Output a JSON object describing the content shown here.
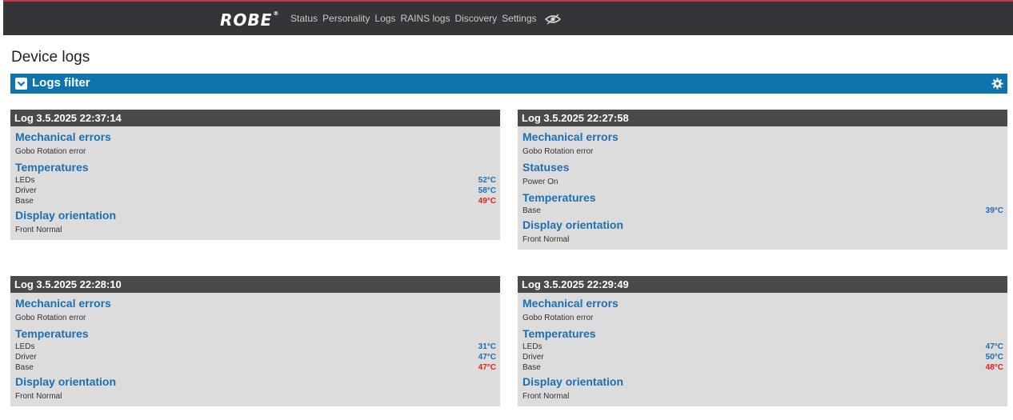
{
  "header": {
    "logo": "ROBE",
    "logo_mark": "®",
    "nav": [
      "Status",
      "Personality",
      "Logs",
      "RAINS logs",
      "Discovery",
      "Settings"
    ],
    "eye_icon": "eye-icon"
  },
  "page": {
    "title": "Device logs"
  },
  "filter": {
    "label": "Logs filter",
    "toggle_icon": "chevron-down-icon",
    "settings_icon": "gear-icon"
  },
  "colors": {
    "accent": "#0f74ad",
    "hot": "#e0231c",
    "topbar": "#333538"
  },
  "logs": [
    {
      "title": "Log 3.5.2025 22:37:14",
      "sections": [
        {
          "heading": "Mechanical errors",
          "items": [
            {
              "label": "Gobo Rotation error"
            }
          ]
        },
        {
          "heading": "Temperatures",
          "items": [
            {
              "label": "LEDs",
              "value": "52°C",
              "status": "normal"
            },
            {
              "label": "Driver",
              "value": "58°C",
              "status": "normal"
            },
            {
              "label": "Base",
              "value": "49°C",
              "status": "hot"
            }
          ]
        },
        {
          "heading": "Display orientation",
          "items": [
            {
              "label": "Front Normal"
            }
          ]
        }
      ]
    },
    {
      "title": "Log 3.5.2025 22:27:58",
      "sections": [
        {
          "heading": "Mechanical errors",
          "items": [
            {
              "label": "Gobo Rotation error"
            }
          ]
        },
        {
          "heading": "Statuses",
          "items": [
            {
              "label": "Power On"
            }
          ]
        },
        {
          "heading": "Temperatures",
          "items": [
            {
              "label": "Base",
              "value": "39°C",
              "status": "normal"
            }
          ]
        },
        {
          "heading": "Display orientation",
          "items": [
            {
              "label": "Front Normal"
            }
          ]
        }
      ]
    },
    {
      "title": "Log 3.5.2025 22:28:10",
      "sections": [
        {
          "heading": "Mechanical errors",
          "items": [
            {
              "label": "Gobo Rotation error"
            }
          ]
        },
        {
          "heading": "Temperatures",
          "items": [
            {
              "label": "LEDs",
              "value": "31°C",
              "status": "normal"
            },
            {
              "label": "Driver",
              "value": "47°C",
              "status": "normal"
            },
            {
              "label": "Base",
              "value": "47°C",
              "status": "hot"
            }
          ]
        },
        {
          "heading": "Display orientation",
          "items": [
            {
              "label": "Front Normal"
            }
          ]
        }
      ]
    },
    {
      "title": "Log 3.5.2025 22:29:49",
      "sections": [
        {
          "heading": "Mechanical errors",
          "items": [
            {
              "label": "Gobo Rotation error"
            }
          ]
        },
        {
          "heading": "Temperatures",
          "items": [
            {
              "label": "LEDs",
              "value": "47°C",
              "status": "normal"
            },
            {
              "label": "Driver",
              "value": "50°C",
              "status": "normal"
            },
            {
              "label": "Base",
              "value": "48°C",
              "status": "hot"
            }
          ]
        },
        {
          "heading": "Display orientation",
          "items": [
            {
              "label": "Front Normal"
            }
          ]
        }
      ]
    }
  ]
}
